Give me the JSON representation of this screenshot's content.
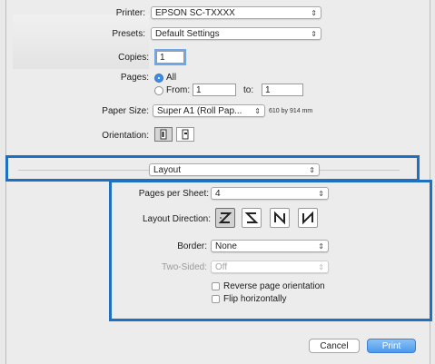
{
  "printer": {
    "label": "Printer:",
    "value": "EPSON SC-TXXXX"
  },
  "presets": {
    "label": "Presets:",
    "value": "Default Settings"
  },
  "copies": {
    "label": "Copies:",
    "value": "1"
  },
  "pages": {
    "label": "Pages:",
    "all_label": "All",
    "from_label": "From:",
    "from_value": "1",
    "to_label": "to:",
    "to_value": "1",
    "selected": "All"
  },
  "paper_size": {
    "label": "Paper Size:",
    "value": "Super A1 (Roll Pap...",
    "dimensions": "610 by 914 mm"
  },
  "orientation": {
    "label": "Orientation:",
    "selected": "portrait"
  },
  "section_popup": {
    "value": "Layout"
  },
  "layout": {
    "pages_per_sheet": {
      "label": "Pages per Sheet:",
      "value": "4"
    },
    "layout_direction": {
      "label": "Layout Direction:",
      "selected_index": 0
    },
    "border": {
      "label": "Border:",
      "value": "None"
    },
    "two_sided": {
      "label": "Two-Sided:",
      "value": "Off",
      "disabled": true
    },
    "reverse_orientation": {
      "label": "Reverse page orientation",
      "checked": false
    },
    "flip_horizontally": {
      "label": "Flip horizontally",
      "checked": false
    }
  },
  "buttons": {
    "cancel": "Cancel",
    "print": "Print"
  },
  "colors": {
    "highlight": "#1f70c1",
    "accent": "#3d8ce8"
  }
}
